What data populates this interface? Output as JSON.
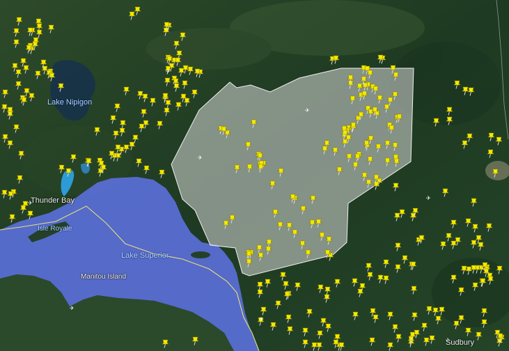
{
  "map": {
    "labels": {
      "lake_nipigon": "Lake Nipigon",
      "thunder_bay": "Thunder Bay",
      "isle_royale": "Isle Royale",
      "lake_superior": "Lake Superior",
      "manitou_island": "Manitou Island",
      "sudbury": "Sudbury"
    },
    "colors": {
      "land": "#1f3a22",
      "lake_superior_fill": "#5a6fd8",
      "lake_nipigon_fill": "#17324a",
      "boundary_line": "#e8e07a",
      "selection_polygon_fill": "#d9d9d9",
      "pin": "#f5ea00"
    },
    "icons": {
      "marker": "yellow-pushpin-icon",
      "town": "airport-icon"
    }
  }
}
